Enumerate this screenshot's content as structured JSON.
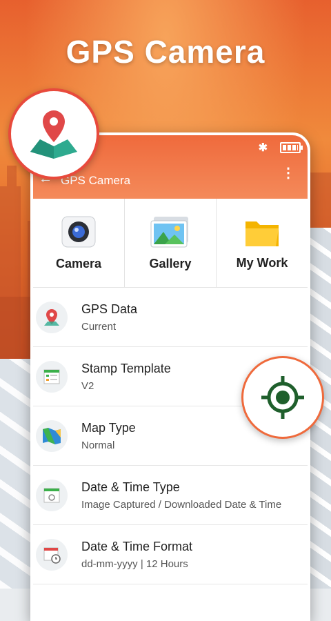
{
  "hero": {
    "title": "GPS Camera"
  },
  "app": {
    "toolbar_title": "GPS Camera",
    "back_glyph": "←",
    "more_glyph": "⋮",
    "bluetooth_glyph": "✱",
    "accent": "#ef6a3c"
  },
  "tiles": [
    {
      "label": "Camera",
      "icon": "camera-icon"
    },
    {
      "label": "Gallery",
      "icon": "gallery-icon"
    },
    {
      "label": "My Work",
      "icon": "folder-icon"
    }
  ],
  "settings": [
    {
      "title": "GPS Data",
      "value": "Current",
      "icon": "location-pin-icon"
    },
    {
      "title": "Stamp Template",
      "value": "V2",
      "icon": "template-icon"
    },
    {
      "title": "Map Type",
      "value": "Normal",
      "icon": "map-icon"
    },
    {
      "title": "Date & Time Type",
      "value": "Image Captured / Downloaded Date & Time",
      "icon": "datetime-type-icon"
    },
    {
      "title": "Date & Time Format",
      "value": "dd-mm-yyyy | 12 Hours",
      "icon": "calendar-clock-icon"
    }
  ]
}
